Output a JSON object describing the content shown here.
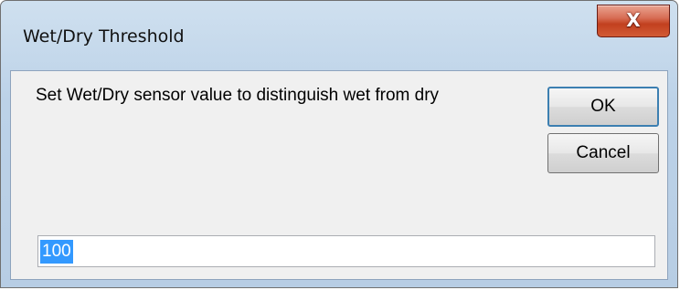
{
  "dialog": {
    "title": "Wet/Dry Threshold",
    "close_glyph": "X",
    "prompt": "Set Wet/Dry sensor value to distinguish wet from dry",
    "ok_label": "OK",
    "cancel_label": "Cancel",
    "threshold_value": "100",
    "selection_color": "#3399ff",
    "ok_focus_color": "#3c7fb1",
    "close_button_color": "#c2401f"
  }
}
